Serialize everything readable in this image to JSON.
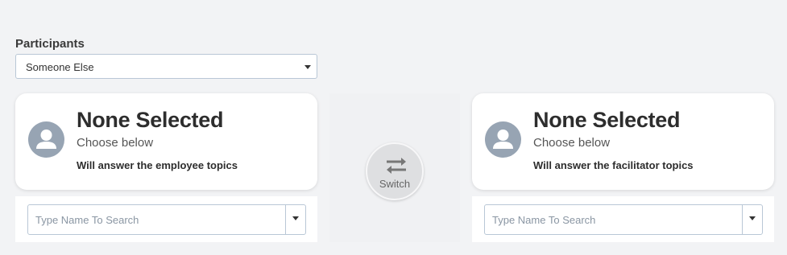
{
  "participants": {
    "label": "Participants",
    "selected": "Someone Else"
  },
  "left_card": {
    "title": "None Selected",
    "subtitle": "Choose below",
    "role": "Will answer the employee topics"
  },
  "right_card": {
    "title": "None Selected",
    "subtitle": "Choose below",
    "role": "Will answer the facilitator topics"
  },
  "switch": {
    "label": "Switch",
    "icon": "swap-arrows-icon"
  },
  "left_search": {
    "placeholder": "Type Name To Search"
  },
  "right_search": {
    "placeholder": "Type Name To Search"
  },
  "colors": {
    "background": "#f2f3f5",
    "avatar": "#97a4b3",
    "border": "#b9c7d6"
  }
}
